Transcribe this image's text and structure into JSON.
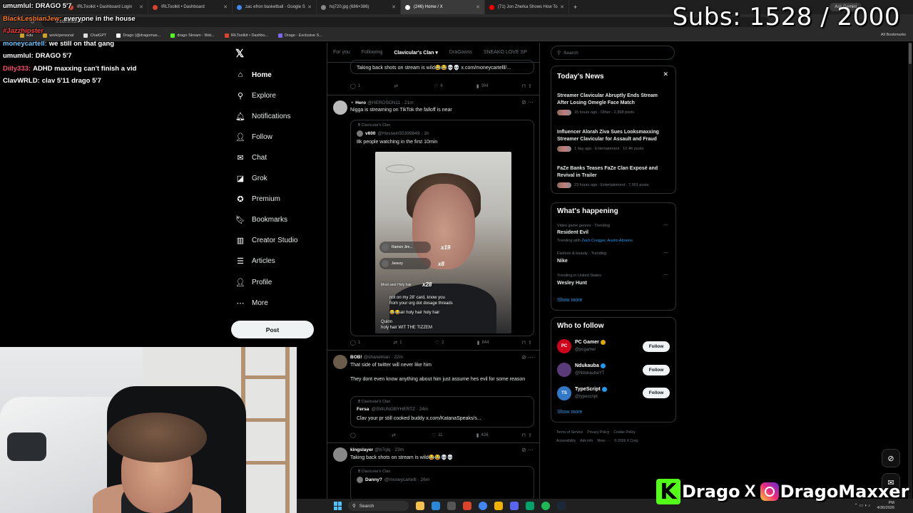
{
  "browser": {
    "tabs": [
      {
        "title": "IRLToolkit • Dashboard Login",
        "color": "#d9442b",
        "active": false
      },
      {
        "title": "IRLToolkit • Dashboard",
        "color": "#d9442b",
        "active": false
      },
      {
        "title": "zac efron basketball - Google S",
        "color": "#4285f4",
        "active": false
      },
      {
        "title": "hq720.jpg (686×386)",
        "color": "#888888",
        "active": false
      },
      {
        "title": "(246) Home / X",
        "color": "#ffffff",
        "active": true
      },
      {
        "title": "(71) Jon Zherka Shows How To",
        "color": "#ff0000",
        "active": false
      }
    ],
    "new_tab": "+",
    "gemini": "Ask Gemini",
    "url": "x.com/home",
    "bookmarks": [
      "edu",
      "work/personal",
      "ChatGPT",
      "Drago (@dragomax...",
      "drago Stream - Wat...",
      "IRLToolkit • Dashbo...",
      "Drago - Exclusive S..."
    ],
    "all_bookmarks": "All Bookmarks"
  },
  "overlay": {
    "subs": "Subs: 1528 / 2000",
    "chat": [
      {
        "user": "umumlul:",
        "text": "DRAGO 5'7",
        "color": "#ffffff"
      },
      {
        "user": "BlackLesbianJew:",
        "text": "everyone in the house",
        "color": "#ff7a1a"
      },
      {
        "user": "#Jazzhipster",
        "text": "",
        "color": "#ff3b3b"
      },
      {
        "user": "moneycartell:",
        "text": "we still on that gang",
        "color": "#6ec6ff"
      },
      {
        "user": "umumlul:",
        "text": "DRAGO 5'7",
        "color": "#ffffff"
      },
      {
        "user": "Dilly333:",
        "text": "ADHD maxxing can't finish a vid",
        "color": "#ff4d6d"
      },
      {
        "user": "ClavWRLD:",
        "text": "clav 5'11 drago 5'7",
        "color": "#ffffff"
      }
    ],
    "brand": {
      "kick_letter": "K",
      "kick_name": "Drago",
      "x_mark": "X",
      "ig_name": "DragoMaxxer"
    }
  },
  "nav": {
    "items": [
      {
        "label": "Home",
        "icon": "⌂",
        "name": "home",
        "active": true
      },
      {
        "label": "Explore",
        "icon": "⚲",
        "name": "explore",
        "active": false
      },
      {
        "label": "Notifications",
        "icon": "🔔︎",
        "name": "notifications",
        "active": false
      },
      {
        "label": "Follow",
        "icon": "👤︎",
        "name": "follow",
        "active": false
      },
      {
        "label": "Chat",
        "icon": "✉",
        "name": "chat",
        "active": false
      },
      {
        "label": "Grok",
        "icon": "◪",
        "name": "grok",
        "active": false
      },
      {
        "label": "Premium",
        "icon": "✪",
        "name": "premium",
        "active": false
      },
      {
        "label": "Bookmarks",
        "icon": "🔖︎",
        "name": "bookmarks",
        "active": false
      },
      {
        "label": "Creator Studio",
        "icon": "▥",
        "name": "creator-studio",
        "active": false
      },
      {
        "label": "Articles",
        "icon": "☰",
        "name": "articles",
        "active": false
      },
      {
        "label": "Profile",
        "icon": "👤︎",
        "name": "profile",
        "active": false
      },
      {
        "label": "More",
        "icon": "⋯",
        "name": "more",
        "active": false
      }
    ],
    "post_label": "Post"
  },
  "feed": {
    "tabs": [
      "For you",
      "Following",
      "Clavicular's Clan",
      "DraGoons",
      "SNEAKO LOVE SP"
    ],
    "active_tab": 2,
    "top_partial": {
      "body": "Taking back shots on stream is wild😂😂💀💀 x.com/moneycartelll/...",
      "actions": {
        "reply": "1",
        "retweet": "",
        "like": "6",
        "views": "394"
      }
    },
    "tweet1": {
      "name": "Hero",
      "handle": "@HEROSON11 · 21m",
      "body": "Nigga is streaming on TikTok the falloff is near",
      "quote_community": "Clavicular's Clan",
      "quote_name": "v600",
      "quote_handle": "@Hussein55399849 · 1h",
      "quote_body": "8k people watching in the first 10min",
      "video_gifts": [
        {
          "name": "Ramon Jim...",
          "sub": "sent Rose",
          "mult": "x19"
        },
        {
          "name": "Jeeezy",
          "sub": "sent Rose",
          "mult": "x8"
        }
      ],
      "video_most": "Most sent Holy hair",
      "video_most_mult": "x28",
      "video_lines": [
        "not on my 28' card, know you",
        "from your org dot dosage threads",
        "😂😂air holy hair holy hair",
        "Quinn",
        "holy hair WIT THE TIZZEM"
      ],
      "actions": {
        "reply": "1",
        "retweet": "1",
        "like": "2",
        "views": "844"
      }
    },
    "tweet2": {
      "name": "BOB!",
      "handle": "@shanetrian · 22m",
      "body1": "That side of twitter will never like him",
      "body2": "They dont even know anything about him just assume hes evil for some reason",
      "quote_community": "Clavicular's Clan",
      "quote_name": "Fersa",
      "quote_handle": "@SWUNGBYHERTZ · 24m",
      "quote_body": "Clav your pr still cooked buddy x.com/KatanaSpeaks/s...",
      "actions": {
        "reply": "",
        "retweet": "",
        "like": "11",
        "views": "426"
      }
    },
    "tweet3": {
      "name": "kingslayer",
      "handle": "@b7qlq · 23m",
      "body": "Taking back shots on stream is wild😂😂💀💀",
      "quote_community": "Clavicular's Clan",
      "quote_name": "Danny?",
      "quote_handle": "@moneycartelll · 26m"
    }
  },
  "sidebar": {
    "search_placeholder": "Search",
    "news_title": "Today's News",
    "news": [
      {
        "title": "Streamer Clavicular Abruptly Ends Stream After Losing Omegle Face Match",
        "meta": "15 hours ago · Other · 2,358 posts"
      },
      {
        "title": "Influencer Alorah Ziva Sues Looksmaxxing Streamer Clavicular for Assault and Fraud",
        "meta": "1 day ago · Entertainment · 10.4K posts"
      },
      {
        "title": "FaZe Banks Teases FaZe Clan Exposé and Revival in Trailer",
        "meta": "23 hours ago · Entertainment · 7,001 posts"
      }
    ],
    "happening_title": "What's happening",
    "trends": [
      {
        "meta": "Video game genres · Trending",
        "name": "Resident Evil",
        "extra_prefix": "Trending with ",
        "extra_links": "Zach Cregger, Austin Abrams"
      },
      {
        "meta": "Fashion & beauty · Trending",
        "name": "Nike",
        "extra_prefix": "",
        "extra_links": ""
      },
      {
        "meta": "Trending in United States",
        "name": "Wesley Hunt",
        "extra_prefix": "",
        "extra_links": ""
      }
    ],
    "show_more": "Show more",
    "wtf_title": "Who to follow",
    "wtf": [
      {
        "name": "PC Gamer",
        "handle": "@pcgamer",
        "badge": "#e0a800",
        "av_color": "#d0021b",
        "av_text": "PC"
      },
      {
        "name": "Ndukauba",
        "handle": "@NdukaubaYT",
        "badge": "#1d9bf0",
        "av_color": "#5a3b7a",
        "av_text": ""
      },
      {
        "name": "TypeScript",
        "handle": "@typescript",
        "badge": "#1d9bf0",
        "av_color": "#3178c6",
        "av_text": "TS"
      }
    ],
    "follow_label": "Follow",
    "footer": [
      "Terms of Service",
      "Privacy Policy",
      "Cookie Policy",
      "Accessibility",
      "Ads info",
      "More ···",
      "© 2026 X Corp."
    ]
  },
  "taskbar": {
    "search": "Search",
    "time": "PM",
    "date": "4/30/2026",
    "app_colors": [
      "#f2c14e",
      "#2b88d8",
      "#555555",
      "#d9442b",
      "#4285f4",
      "#f0b400",
      "#5865f2",
      "#00a36c",
      "#1db954",
      "#1b2838"
    ]
  }
}
